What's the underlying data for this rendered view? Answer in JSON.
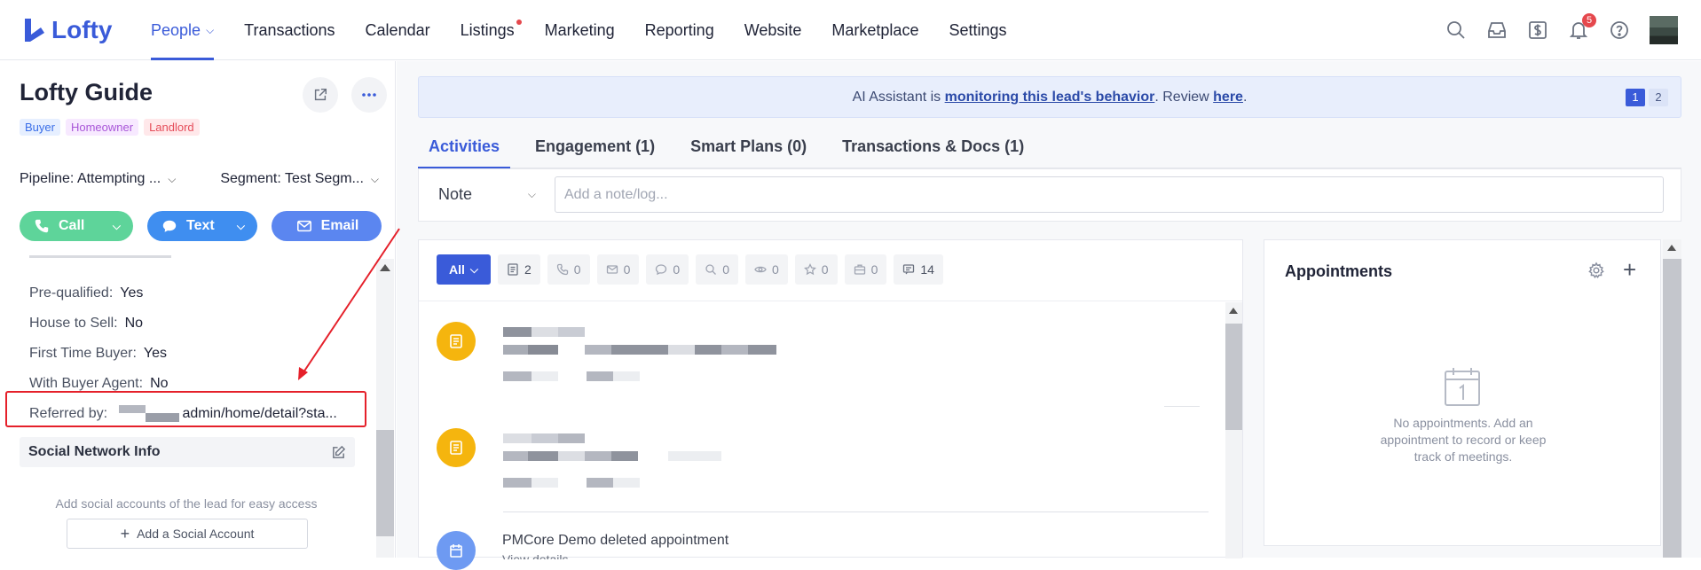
{
  "app": {
    "logo_text": "Lofty",
    "brand_color": "#3a5bd9"
  },
  "nav": {
    "items": [
      {
        "label": "People",
        "active": true,
        "has_dropdown": true
      },
      {
        "label": "Transactions"
      },
      {
        "label": "Calendar"
      },
      {
        "label": "Listings",
        "has_dot": true
      },
      {
        "label": "Marketing"
      },
      {
        "label": "Reporting"
      },
      {
        "label": "Website"
      },
      {
        "label": "Marketplace"
      },
      {
        "label": "Settings"
      }
    ],
    "icons": [
      "search-icon",
      "inbox-icon",
      "dollar-icon",
      "bell-icon",
      "help-icon"
    ],
    "notification_count": "5"
  },
  "lead": {
    "name": "Lofty Guide",
    "tags": [
      "Buyer",
      "Homeowner",
      "Landlord"
    ],
    "pipeline": "Pipeline: Attempting ...",
    "segment": "Segment: Test Segm...",
    "actions": {
      "call": "Call",
      "text": "Text",
      "email": "Email"
    },
    "details": [
      {
        "label": "Pre-qualified:",
        "value": "Yes"
      },
      {
        "label": "House to Sell:",
        "value": "No"
      },
      {
        "label": "First Time Buyer:",
        "value": "Yes"
      },
      {
        "label": "With Buyer Agent:",
        "value": "No"
      }
    ],
    "referred_label": "Referred by:",
    "referred_value": "admin/home/detail?sta...",
    "social_title": "Social Network Info",
    "social_desc": "Add social accounts of the lead for easy access",
    "add_social": "Add a Social Account"
  },
  "banner": {
    "prefix": "AI Assistant is ",
    "link1": "monitoring this lead's behavior",
    "middle": ". Review ",
    "link2": "here",
    "suffix": ".",
    "pages": [
      "1",
      "2"
    ]
  },
  "tabs": [
    "Activities",
    "Engagement (1)",
    "Smart Plans (0)",
    "Transactions & Docs (1)"
  ],
  "note": {
    "type": "Note",
    "placeholder": "Add a note/log..."
  },
  "filters": {
    "all": "All",
    "chips": [
      {
        "icon": "note-icon",
        "count": "2"
      },
      {
        "icon": "phone-icon",
        "count": "0"
      },
      {
        "icon": "mail-icon",
        "count": "0"
      },
      {
        "icon": "chat-icon",
        "count": "0"
      },
      {
        "icon": "search-icon",
        "count": "0"
      },
      {
        "icon": "eye-icon",
        "count": "0"
      },
      {
        "icon": "star-icon",
        "count": "0"
      },
      {
        "icon": "briefcase-icon",
        "count": "0"
      },
      {
        "icon": "message-icon",
        "count": "14"
      }
    ]
  },
  "feed": {
    "last_text": "PMCore Demo deleted appointment",
    "last_sub": "View details"
  },
  "appointments": {
    "title": "Appointments",
    "empty_text": "No appointments. Add an appointment to record or keep track of meetings."
  }
}
